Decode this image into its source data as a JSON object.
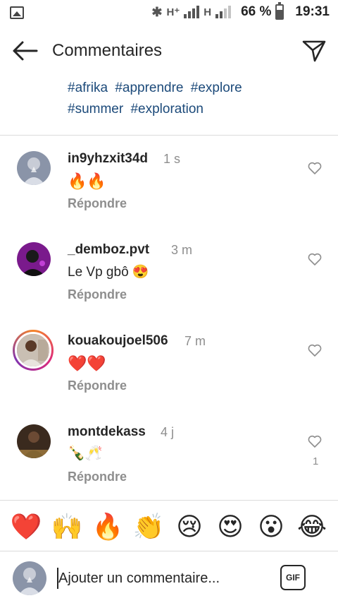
{
  "status_bar": {
    "battery_percent": "66 %",
    "time": "19:31",
    "network_1": "H⁺",
    "network_2": "H"
  },
  "header": {
    "title": "Commentaires",
    "back_icon": "arrow-left-icon",
    "send_icon": "paper-plane-icon"
  },
  "caption": {
    "hashtags": [
      "#afrika",
      "#apprendre",
      "#explore",
      "#summer",
      "#exploration"
    ]
  },
  "comments": [
    {
      "username": "in9yhzxit34d",
      "time": "1 s",
      "text": "🔥🔥",
      "reply_label": "Répondre",
      "likes": ""
    },
    {
      "username": "_demboz.pvt",
      "time": "3 m",
      "text": "Le Vp gbô 😍",
      "reply_label": "Répondre",
      "likes": ""
    },
    {
      "username": "kouakoujoel506",
      "time": "7 m",
      "text": "❤️❤️",
      "reply_label": "Répondre",
      "likes": ""
    },
    {
      "username": "montdekass",
      "time": "4 j",
      "text": "🍾🥂",
      "reply_label": "Répondre",
      "likes": "1"
    }
  ],
  "emoji_bar": [
    "❤️",
    "🙌",
    "🔥",
    "👏",
    "😢",
    "😍",
    "😮",
    "😂"
  ],
  "composer": {
    "placeholder": "Ajouter un commentaire...",
    "gif_label": "GIF"
  },
  "colors": {
    "hashtag": "#1c4a7a",
    "muted": "#8e8e8e",
    "text": "#262626"
  }
}
